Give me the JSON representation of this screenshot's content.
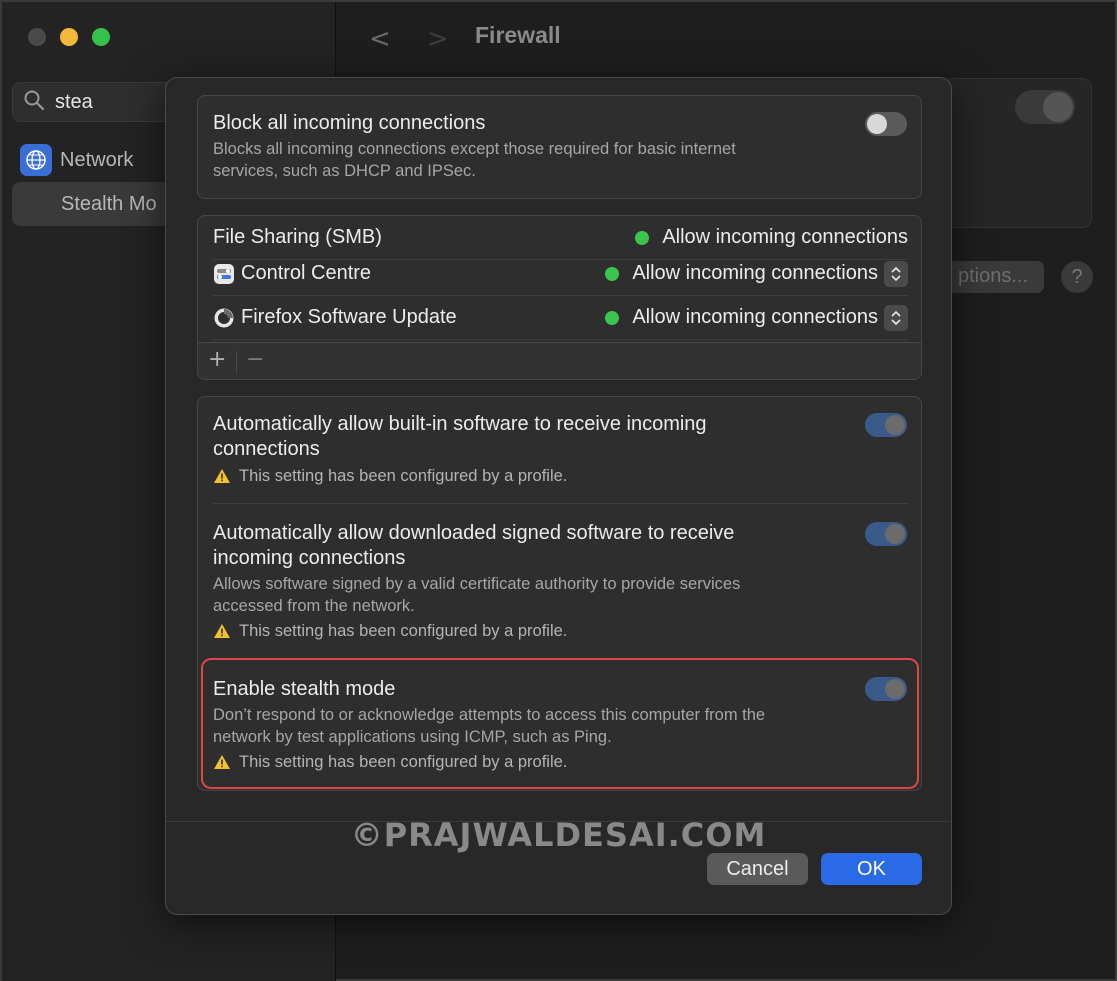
{
  "window": {
    "title": "Firewall"
  },
  "sidebar": {
    "search_value": "stea",
    "items": [
      {
        "label": "Network",
        "icon": "globe-icon"
      },
      {
        "label": "Stealth Mo"
      }
    ]
  },
  "background": {
    "options_label": "ptions...",
    "help_label": "?"
  },
  "block_all": {
    "title": "Block all incoming connections",
    "description_line1": "Blocks all incoming connections except those required for basic internet",
    "description_line2": "services, such as DHCP and IPSec.",
    "enabled": false
  },
  "apps": [
    {
      "name": "File Sharing (SMB)",
      "status": "Allow incoming connections",
      "has_stepper": false,
      "has_icon": false
    },
    {
      "name": "Control Centre",
      "status": "Allow incoming connections",
      "has_stepper": true,
      "has_icon": true,
      "icon": "control-centre-icon"
    },
    {
      "name": "Firefox Software Update",
      "status": "Allow incoming connections",
      "has_stepper": true,
      "has_icon": true,
      "icon": "firefox-icon"
    }
  ],
  "toolbar": {
    "add": "+",
    "remove": "−"
  },
  "auto_builtin": {
    "title_line1": "Automatically allow built-in software to receive incoming",
    "title_line2": "connections",
    "warning": "This setting has been configured by a profile.",
    "enabled": true
  },
  "auto_signed": {
    "title_line1": "Automatically allow downloaded signed software to receive",
    "title_line2": "incoming connections",
    "description_line1": "Allows software signed by a valid certificate authority to provide services",
    "description_line2": "accessed from the network.",
    "warning": "This setting has been configured by a profile.",
    "enabled": true
  },
  "stealth": {
    "title": "Enable stealth mode",
    "description_line1": "Don’t respond to or acknowledge attempts to access this computer from the",
    "description_line2": "network by test applications using ICMP, such as Ping.",
    "warning": "This setting has been configured by a profile.",
    "enabled": true
  },
  "watermark": "©PRAJWALDESAI.COM",
  "buttons": {
    "cancel": "Cancel",
    "ok": "OK"
  },
  "colors": {
    "accent": "#2a6ae6",
    "status_green": "#3cc54e",
    "highlight": "#e0434a"
  }
}
